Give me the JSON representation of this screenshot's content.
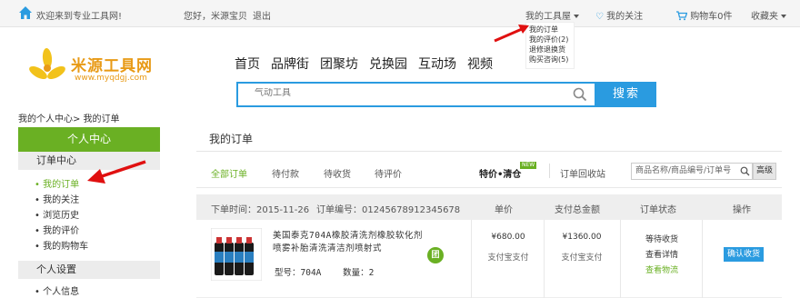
{
  "topbar": {
    "welcome": "欢迎来到专业工具网!",
    "greeting": "您好，米源宝贝",
    "logout": "退出",
    "my_tools": "我的工具屋",
    "my_follow": "我的关注",
    "cart": "购物车0件",
    "favorites": "收藏夹"
  },
  "dropdown": {
    "items": [
      "我的订单",
      "我的评价(2)",
      "退修退换货",
      "购买咨询(5)"
    ]
  },
  "logo": {
    "name": "米源工具网",
    "url": "www.myqdgj.com"
  },
  "nav": {
    "items": [
      "首页",
      "品牌街",
      "团聚坊",
      "兑换园",
      "互动场",
      "视频"
    ]
  },
  "search": {
    "placeholder": "气动工具",
    "button": "搜索"
  },
  "breadcrumb": "我的个人中心> 我的订单",
  "sidebar": {
    "header": "个人中心",
    "group1": "订单中心",
    "items": [
      "• 我的订单",
      "• 我的关注",
      "• 浏览历史",
      "• 我的评价",
      "• 我的购物车"
    ],
    "group2": "个人设置",
    "items2": [
      "• 个人信息"
    ]
  },
  "main": {
    "title": "我的订单",
    "tabs": [
      "全部订单",
      "待付款",
      "待收货",
      "待评价"
    ],
    "special": "特价•清仓",
    "new_badge": "NEW",
    "recycle": "订单回收站",
    "order_search_placeholder": "商品名称/商品编号/订单号",
    "advanced": "高级"
  },
  "order": {
    "time_label": "下单时间：",
    "time": "2015-11-26",
    "number_label": "订单编号：",
    "number": "01245678912345678",
    "col_price": "单价",
    "col_total": "支付总金额",
    "col_status": "订单状态",
    "col_action": "操作",
    "product_name": "美国泰克704A橡胶清洗剂橡胶软化剂喷雾补胎清洗清洁剂喷射式",
    "model_label": "型号：",
    "model": "704A",
    "qty_label": "数量：",
    "qty": "2",
    "tuan": "团",
    "unit_price": "¥680.00",
    "pay_method": "支付宝支付",
    "total": "¥1360.00",
    "pay_method2": "支付宝支付",
    "status": "等待收货",
    "detail_link": "查看详情",
    "logistics_link": "查看物流",
    "confirm": "确认收货"
  },
  "colors": {
    "green": "#6ab023",
    "blue": "#2a9be0",
    "arrow_red": "#e01010",
    "logo_orange": "#e89a16"
  }
}
